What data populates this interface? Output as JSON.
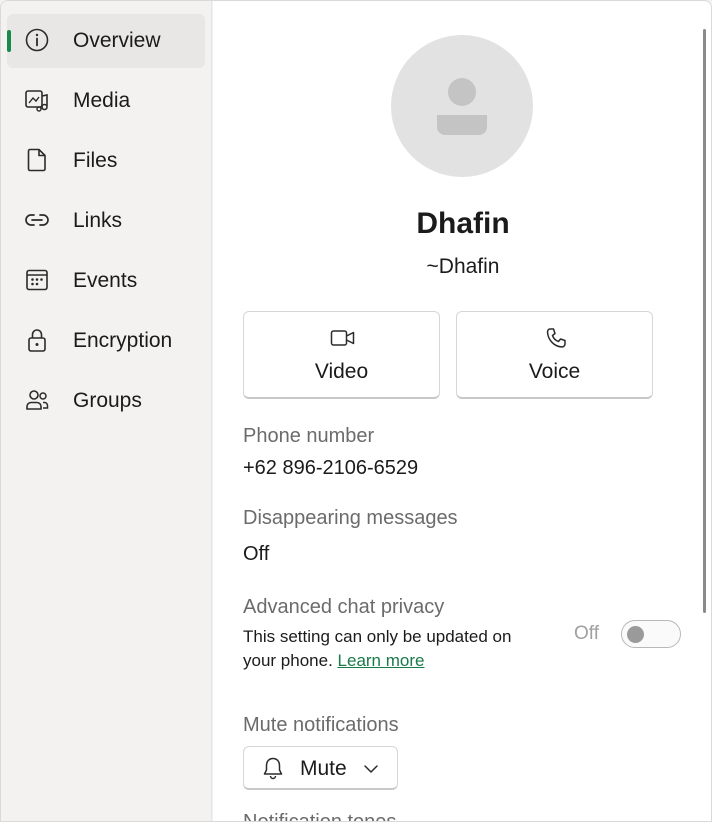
{
  "sidebar": {
    "items": [
      {
        "label": "Overview",
        "icon": "info-icon",
        "active": true
      },
      {
        "label": "Media",
        "icon": "media-icon"
      },
      {
        "label": "Files",
        "icon": "file-icon"
      },
      {
        "label": "Links",
        "icon": "link-icon"
      },
      {
        "label": "Events",
        "icon": "calendar-icon"
      },
      {
        "label": "Encryption",
        "icon": "lock-icon"
      },
      {
        "label": "Groups",
        "icon": "people-icon"
      }
    ]
  },
  "contact": {
    "name": "Dhafin",
    "handle": "~Dhafin"
  },
  "actions": {
    "video_label": "Video",
    "voice_label": "Voice"
  },
  "phone": {
    "label": "Phone number",
    "value": "+62 896-2106-6529"
  },
  "disappearing": {
    "label": "Disappearing messages",
    "value": "Off"
  },
  "privacy": {
    "label": "Advanced chat privacy",
    "description": "This setting can only be updated on your phone.",
    "link": "Learn more",
    "toggle_state": "Off"
  },
  "mute": {
    "label": "Mute notifications",
    "button_label": "Mute"
  },
  "next_section_label": "Notification tones",
  "colors": {
    "accent": "#1a8a4a",
    "link": "#1a7a4a"
  }
}
